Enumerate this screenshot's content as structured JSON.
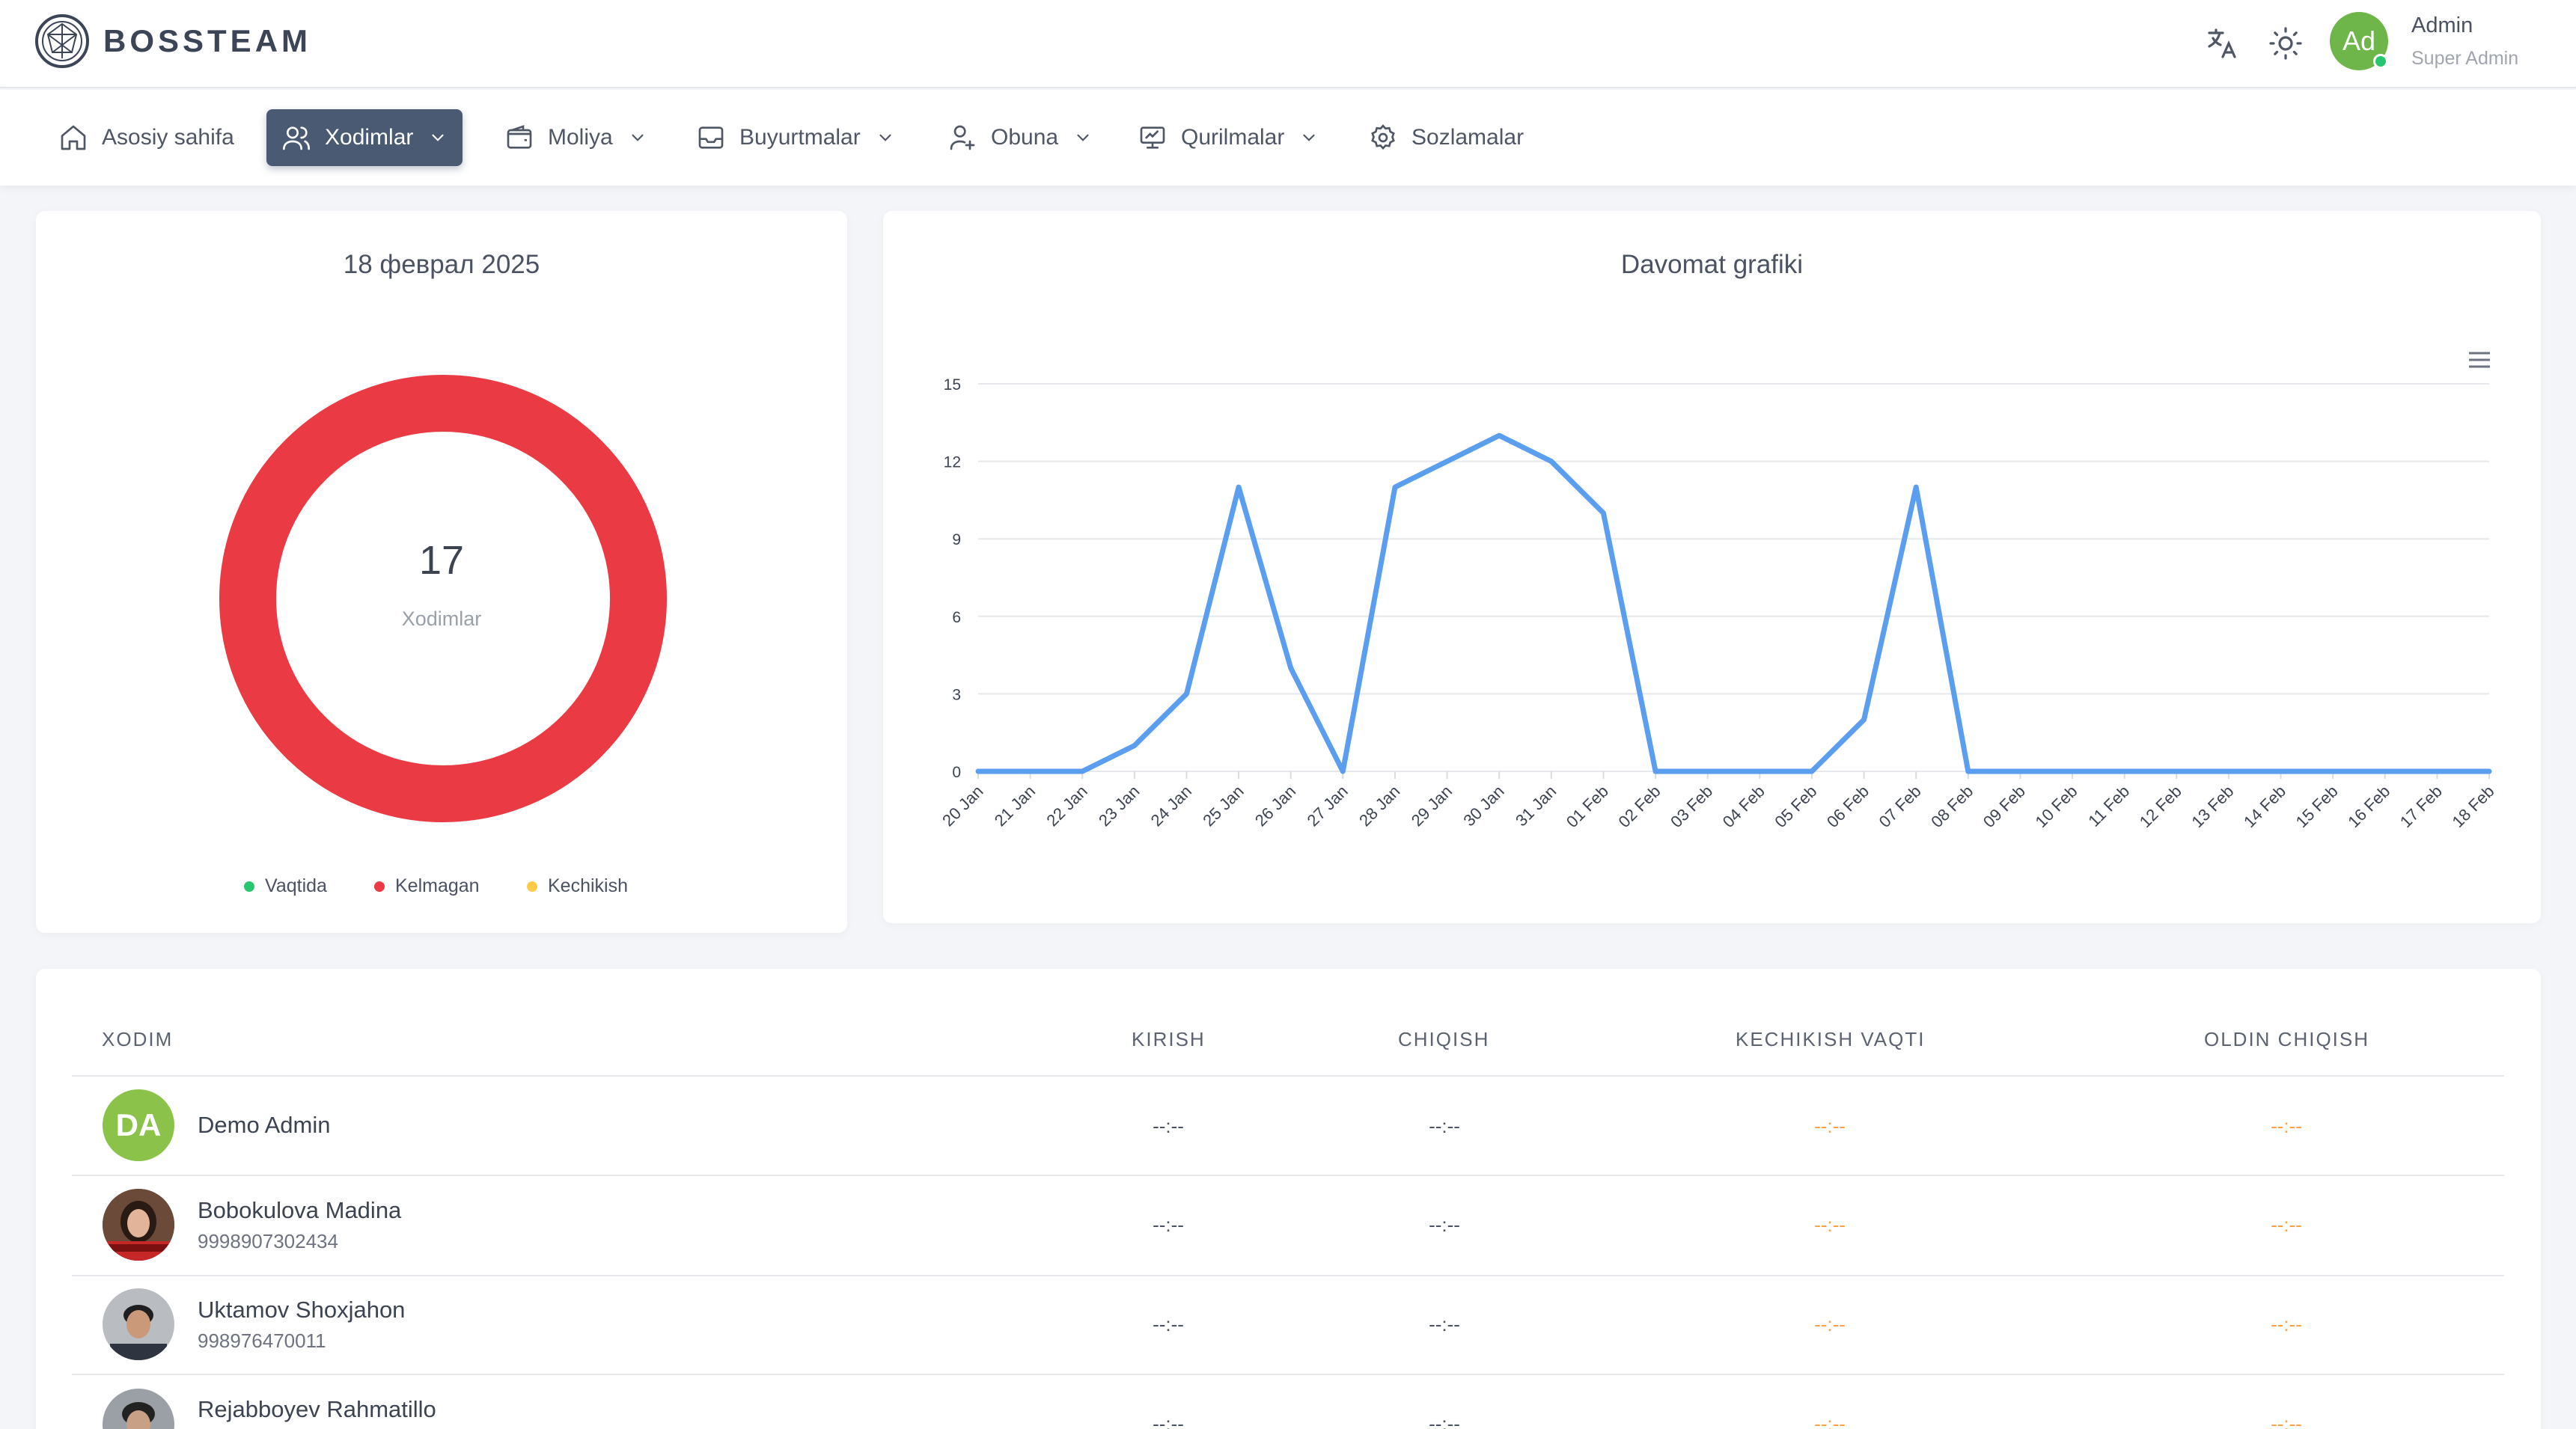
{
  "brand": {
    "name": "BOSSTEAM"
  },
  "header": {
    "user_name": "Admin",
    "user_role": "Super Admin",
    "avatar_initials": "Ad",
    "icons": [
      "translate-icon",
      "sun-icon"
    ]
  },
  "nav": {
    "items": [
      {
        "label": "Asosiy sahifa",
        "icon": "home-icon",
        "dropdown": false,
        "active": false
      },
      {
        "label": "Xodimlar",
        "icon": "users-icon",
        "dropdown": true,
        "active": true
      },
      {
        "label": "Moliya",
        "icon": "wallet-icon",
        "dropdown": true,
        "active": false
      },
      {
        "label": "Buyurtmalar",
        "icon": "inbox-icon",
        "dropdown": true,
        "active": false
      },
      {
        "label": "Obuna",
        "icon": "user-plus-icon",
        "dropdown": true,
        "active": false
      },
      {
        "label": "Qurilmalar",
        "icon": "monitor-icon",
        "dropdown": true,
        "active": false
      },
      {
        "label": "Sozlamalar",
        "icon": "gear-icon",
        "dropdown": false,
        "active": false
      }
    ]
  },
  "donut": {
    "title": "18 феврал 2025",
    "total": "17",
    "total_label": "Xodimlar",
    "legend": [
      {
        "label": "Vaqtida",
        "color": "#28c76f"
      },
      {
        "label": "Kelmagan",
        "color": "#ea3a44"
      },
      {
        "label": "Kechikish",
        "color": "#ffc94a"
      }
    ]
  },
  "chart_data": {
    "type": "line",
    "title": "Davomat grafiki",
    "color": "#5b9ef0",
    "x": [
      "20 Jan",
      "21 Jan",
      "22 Jan",
      "23 Jan",
      "24 Jan",
      "25 Jan",
      "26 Jan",
      "27 Jan",
      "28 Jan",
      "29 Jan",
      "30 Jan",
      "31 Jan",
      "01 Feb",
      "02 Feb",
      "03 Feb",
      "04 Feb",
      "05 Feb",
      "06 Feb",
      "07 Feb",
      "08 Feb",
      "09 Feb",
      "10 Feb",
      "11 Feb",
      "12 Feb",
      "13 Feb",
      "14 Feb",
      "15 Feb",
      "16 Feb",
      "17 Feb",
      "18 Feb"
    ],
    "values": [
      0,
      0,
      0,
      1,
      3,
      11,
      4,
      0,
      11,
      12,
      13,
      12,
      10,
      0,
      0,
      0,
      0,
      2,
      11,
      0,
      0,
      0,
      0,
      0,
      0,
      0,
      0,
      0,
      0,
      0
    ],
    "yticks": [
      0,
      3,
      6,
      9,
      12,
      15
    ],
    "ylim": [
      0,
      15
    ],
    "grid": true
  },
  "table": {
    "headers": {
      "employee": "XODIM",
      "in": "KIRISH",
      "out": "CHIQISH",
      "late": "KECHIKISH VAQTI",
      "early": "OLDIN CHIQISH"
    },
    "rows": [
      {
        "name": "Demo Admin",
        "phone": "",
        "initials": "DA",
        "in": "--:--",
        "out": "--:--",
        "late": "--:--",
        "early": "--:--"
      },
      {
        "name": "Bobokulova Madina",
        "phone": "9998907302434",
        "initials": "",
        "in": "--:--",
        "out": "--:--",
        "late": "--:--",
        "early": "--:--"
      },
      {
        "name": "Uktamov Shoxjahon",
        "phone": "998976470011",
        "initials": "",
        "in": "--:--",
        "out": "--:--",
        "late": "--:--",
        "early": "--:--"
      },
      {
        "name": "Rejabboyev Rahmatillo",
        "phone": "",
        "initials": "",
        "in": "--:--",
        "out": "--:--",
        "late": "--:--",
        "early": "--:--"
      }
    ]
  }
}
